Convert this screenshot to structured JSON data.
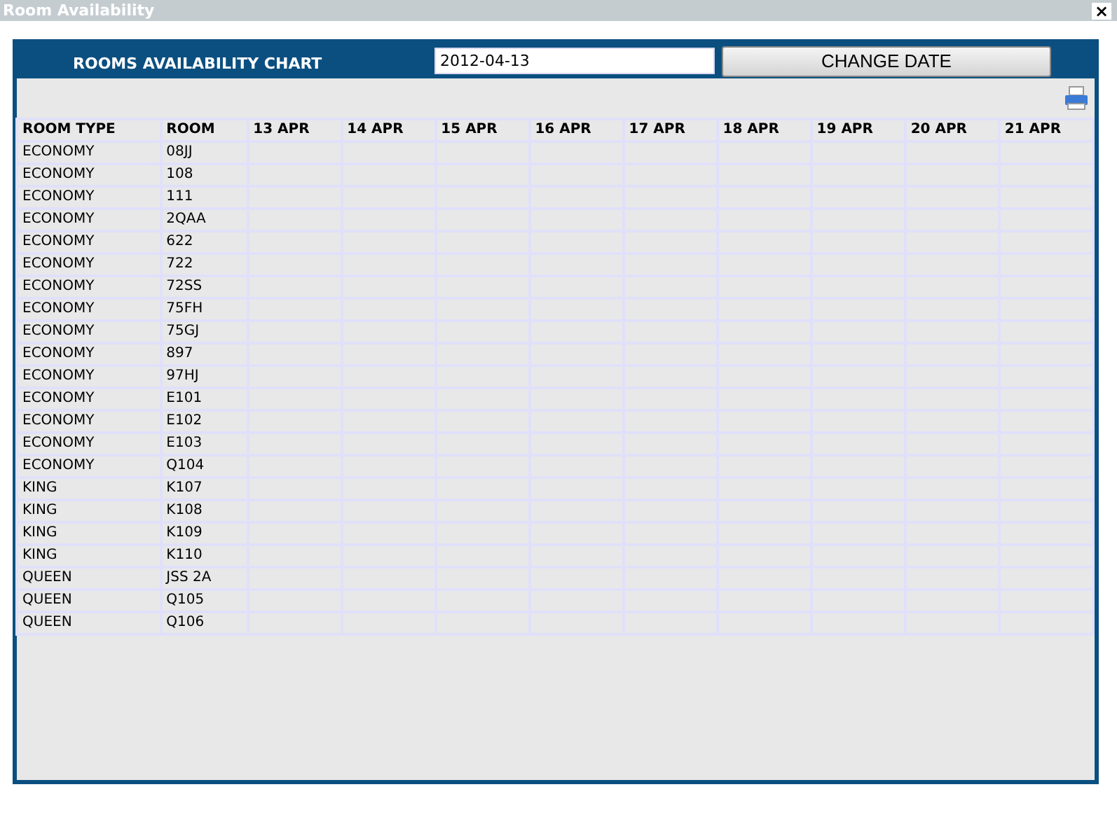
{
  "window": {
    "title": "Room Availability",
    "close": "×"
  },
  "chart_title": "ROOMS AVAILABILITY CHART",
  "date_field": {
    "value": "2012-04-13"
  },
  "change_button": "CHANGE DATE",
  "table": {
    "columns": [
      "ROOM TYPE",
      "ROOM",
      "13 APR",
      "14 APR",
      "15 APR",
      "16 APR",
      "17 APR",
      "18 APR",
      "19 APR",
      "20 APR",
      "21 APR"
    ],
    "rows": [
      {
        "room_type": "ECONOMY",
        "room": "08JJ"
      },
      {
        "room_type": "ECONOMY",
        "room": "108"
      },
      {
        "room_type": "ECONOMY",
        "room": "111"
      },
      {
        "room_type": "ECONOMY",
        "room": "2QAA"
      },
      {
        "room_type": "ECONOMY",
        "room": "622"
      },
      {
        "room_type": "ECONOMY",
        "room": "722"
      },
      {
        "room_type": "ECONOMY",
        "room": "72SS"
      },
      {
        "room_type": "ECONOMY",
        "room": "75FH"
      },
      {
        "room_type": "ECONOMY",
        "room": "75GJ"
      },
      {
        "room_type": "ECONOMY",
        "room": "897"
      },
      {
        "room_type": "ECONOMY",
        "room": "97HJ"
      },
      {
        "room_type": "ECONOMY",
        "room": "E101"
      },
      {
        "room_type": "ECONOMY",
        "room": "E102"
      },
      {
        "room_type": "ECONOMY",
        "room": "E103"
      },
      {
        "room_type": "ECONOMY",
        "room": "Q104"
      },
      {
        "room_type": "KING",
        "room": "K107"
      },
      {
        "room_type": "KING",
        "room": "K108"
      },
      {
        "room_type": "KING",
        "room": "K109"
      },
      {
        "room_type": "KING",
        "room": "K110"
      },
      {
        "room_type": "QUEEN",
        "room": "JSS 2A"
      },
      {
        "room_type": "QUEEN",
        "room": "Q105"
      },
      {
        "room_type": "QUEEN",
        "room": "Q106"
      }
    ]
  }
}
